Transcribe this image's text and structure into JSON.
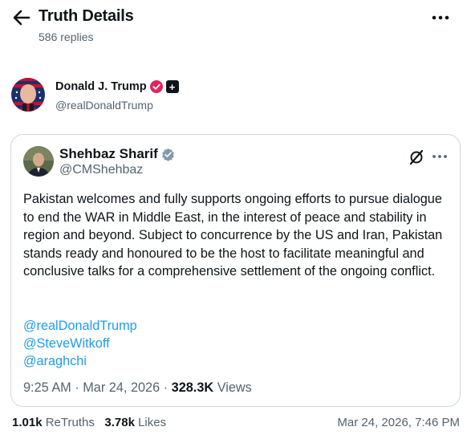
{
  "header": {
    "title": "Truth Details",
    "replies": "586 replies"
  },
  "author": {
    "name": "Donald J. Trump",
    "handle": "@realDonaldTrump",
    "plus_badge": "+"
  },
  "quote": {
    "name": "Shehbaz Sharif",
    "handle": "@CMShehbaz",
    "body": "Pakistan welcomes and fully supports ongoing efforts to pursue dialogue to end the WAR in Middle East, in the interest of peace and stability in region and beyond. Subject to concurrence by the US and Iran, Pakistan stands ready and honoured to be the host to facilitate meaningful and conclusive talks for a comprehensive settlement of the ongoing conflict.",
    "mentions": [
      "@realDonaldTrump",
      "@SteveWitkoff",
      "@araghchi"
    ],
    "time": "9:25 AM",
    "date": "Mar 24, 2026",
    "views_count": "328.3K",
    "views_label": "Views"
  },
  "footer": {
    "retruths_count": "1.01k",
    "retruths_label": "ReTruths",
    "likes_count": "3.78k",
    "likes_label": "Likes",
    "timestamp": "Mar 24, 2026, 7:46 PM"
  },
  "colors": {
    "link": "#1d9bf0",
    "muted": "#536471",
    "verify_pink": "#e0245e",
    "verify_gray": "#829aab",
    "border": "#cfd9de"
  },
  "icons": {
    "back": "arrow-left-icon",
    "more": "more-horizontal-icon",
    "x_logo": "x-logo-icon"
  }
}
